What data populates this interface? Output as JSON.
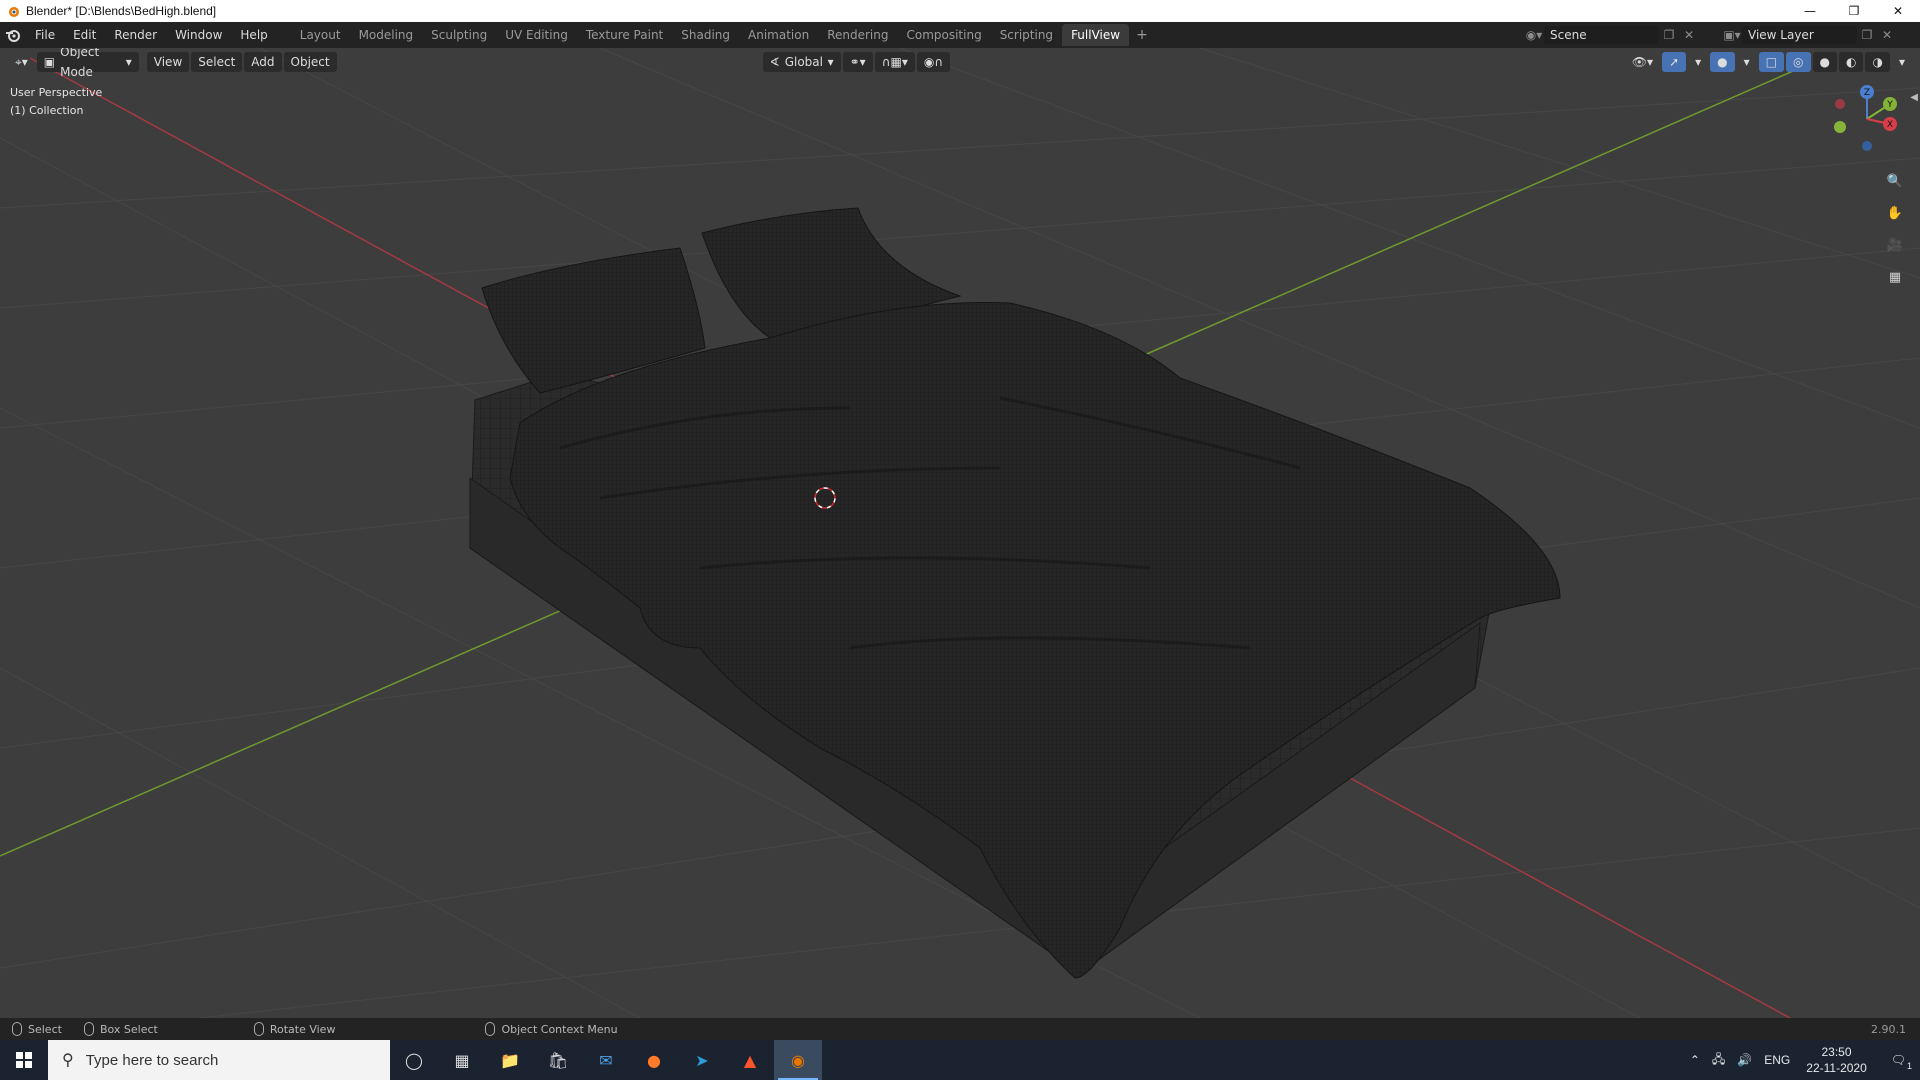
{
  "window": {
    "title": "Blender* [D:\\Blends\\BedHigh.blend]",
    "controls": [
      "minimize-icon",
      "restore-icon",
      "close-icon"
    ]
  },
  "topbar": {
    "menus": [
      "File",
      "Edit",
      "Render",
      "Window",
      "Help"
    ],
    "workspaces": [
      "Layout",
      "Modeling",
      "Sculpting",
      "UV Editing",
      "Texture Paint",
      "Shading",
      "Animation",
      "Rendering",
      "Compositing",
      "Scripting",
      "FullView"
    ],
    "active_workspace": "FullView",
    "add_tab": "+",
    "scene": "Scene",
    "view_layer": "View Layer"
  },
  "viewport": {
    "mode": "Object Mode",
    "menus": [
      "View",
      "Select",
      "Add",
      "Object"
    ],
    "orientation": "Global",
    "hint_line1": "User Perspective",
    "hint_line2": "(1) Collection",
    "gizmo": {
      "x": "X",
      "y": "Y",
      "z": "Z"
    },
    "nav_tools": [
      "zoom-icon",
      "pan-hand-icon",
      "camera-icon",
      "grid-ortho-icon"
    ]
  },
  "statusbar": {
    "select": "Select",
    "box_select": "Box Select",
    "rotate_view": "Rotate View",
    "context_menu": "Object Context Menu",
    "version": "2.90.1"
  },
  "taskbar": {
    "search_placeholder": "Type here to search",
    "apps": [
      "cortana-icon",
      "task-view-icon",
      "file-explorer-icon",
      "store-icon",
      "mail-icon",
      "firefox-icon",
      "vscode-icon",
      "brave-icon",
      "blender-icon"
    ],
    "active_app": "blender-icon",
    "lang": "ENG",
    "time": "23:50",
    "date": "22-11-2020",
    "notification_count": "1"
  },
  "colors": {
    "axis_x": "#b0343a",
    "axis_y": "#6a9a2c",
    "viewport_bg": "#3d3d3d",
    "active_tab": "#3b3b3b"
  }
}
